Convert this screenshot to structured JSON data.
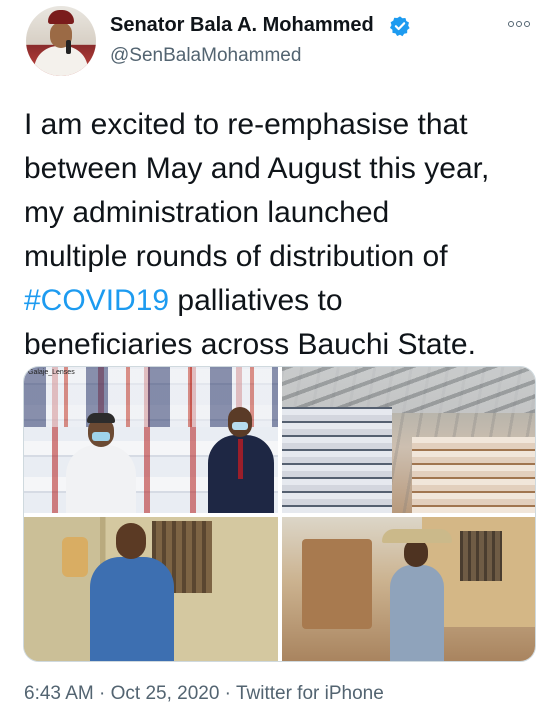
{
  "author": {
    "name": "Senator Bala A. Mohammed",
    "handle": "@SenBalaMohammed",
    "verified": true
  },
  "tweet": {
    "lines": [
      "I am excited to re-emphasise that",
      "between May and August this year,",
      "my administration launched",
      "multiple rounds of distribution of"
    ],
    "hashtag": "#COVID19",
    "line5_rest": " palliatives to",
    "line6": "beneficiaries across Bauchi State."
  },
  "media": {
    "photo1_watermark": "Galaje_Lenses"
  },
  "footer": {
    "time": "6:43 AM",
    "sep1": " · ",
    "date": "Oct 25, 2020",
    "sep2": " · ",
    "source": "Twitter for iPhone"
  },
  "icons": {
    "verified": "verified-badge-icon",
    "more": "more-options-icon"
  },
  "colors": {
    "accent": "#1d9bf0",
    "text": "#0f1419",
    "secondary": "#536471",
    "border": "#cfd9de"
  }
}
